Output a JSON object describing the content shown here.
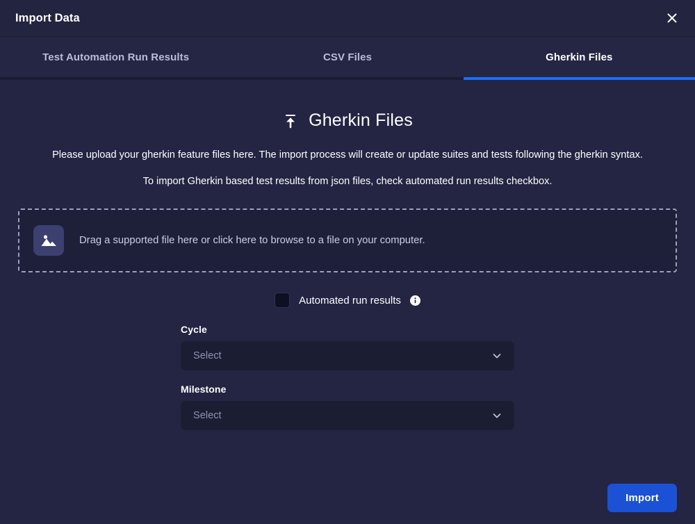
{
  "dialog": {
    "title": "Import Data",
    "close_icon": "close-icon"
  },
  "tabs": [
    {
      "label": "Test Automation Run Results",
      "active": false
    },
    {
      "label": "CSV Files",
      "active": false
    },
    {
      "label": "Gherkin Files",
      "active": true
    }
  ],
  "section": {
    "icon": "upload-icon",
    "title": "Gherkin Files",
    "description_line_1": "Please upload your gherkin feature files here. The import process will create or update suites and tests following the gherkin syntax.",
    "description_line_2": "To import Gherkin based test results from json files, check automated run results checkbox."
  },
  "drop_zone": {
    "icon": "image-file-icon",
    "text": "Drag a supported file here or click here to browse to a file on your computer."
  },
  "automated_run_results": {
    "label": "Automated run results",
    "checked": false,
    "info_icon": "info-icon"
  },
  "fields": [
    {
      "label": "Cycle",
      "value": "Select",
      "placeholder": "Select"
    },
    {
      "label": "Milestone",
      "value": "Select",
      "placeholder": "Select"
    }
  ],
  "footer": {
    "import_label": "Import"
  },
  "colors": {
    "accent_blue": "#1a6dfb",
    "button_blue": "#1b51d4",
    "background": "#232543",
    "header_background": "#222440",
    "panel_dark": "#1e2039",
    "input_dark": "#1b1d33"
  }
}
